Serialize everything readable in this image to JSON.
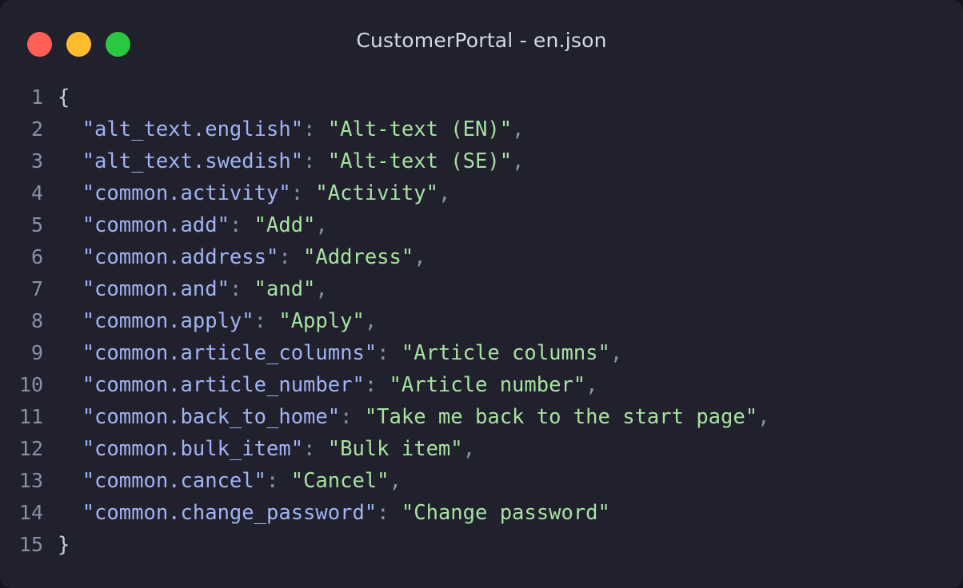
{
  "window": {
    "title": "CustomerPortal - en.json",
    "controls": [
      {
        "name": "close",
        "color": "#ff5f56"
      },
      {
        "name": "minimize",
        "color": "#ffbd2e"
      },
      {
        "name": "maximize",
        "color": "#28c840"
      }
    ]
  },
  "editor": {
    "language": "json",
    "colors": {
      "background": "#21212e",
      "line_number": "#8b90a8",
      "key": "#9fb4f2",
      "string": "#a7e2a0",
      "punctuation": "#c9ccda"
    },
    "lines": [
      {
        "number": "1",
        "indent": 0,
        "type": "brace",
        "text": "{"
      },
      {
        "number": "2",
        "indent": 1,
        "type": "pair",
        "key": "alt_text.english",
        "value": "Alt-text (EN)",
        "comma": ","
      },
      {
        "number": "3",
        "indent": 1,
        "type": "pair",
        "key": "alt_text.swedish",
        "value": "Alt-text (SE)",
        "comma": ","
      },
      {
        "number": "4",
        "indent": 1,
        "type": "pair",
        "key": "common.activity",
        "value": "Activity",
        "comma": ","
      },
      {
        "number": "5",
        "indent": 1,
        "type": "pair",
        "key": "common.add",
        "value": "Add",
        "comma": ","
      },
      {
        "number": "6",
        "indent": 1,
        "type": "pair",
        "key": "common.address",
        "value": "Address",
        "comma": ","
      },
      {
        "number": "7",
        "indent": 1,
        "type": "pair",
        "key": "common.and",
        "value": "and",
        "comma": ","
      },
      {
        "number": "8",
        "indent": 1,
        "type": "pair",
        "key": "common.apply",
        "value": "Apply",
        "comma": ","
      },
      {
        "number": "9",
        "indent": 1,
        "type": "pair",
        "key": "common.article_columns",
        "value": "Article columns",
        "comma": ","
      },
      {
        "number": "10",
        "indent": 1,
        "type": "pair",
        "key": "common.article_number",
        "value": "Article number",
        "comma": ","
      },
      {
        "number": "11",
        "indent": 1,
        "type": "pair",
        "key": "common.back_to_home",
        "value": "Take me back to the start page",
        "comma": ","
      },
      {
        "number": "12",
        "indent": 1,
        "type": "pair",
        "key": "common.bulk_item",
        "value": "Bulk item",
        "comma": ","
      },
      {
        "number": "13",
        "indent": 1,
        "type": "pair",
        "key": "common.cancel",
        "value": "Cancel",
        "comma": ","
      },
      {
        "number": "14",
        "indent": 1,
        "type": "pair",
        "key": "common.change_password",
        "value": "Change password",
        "comma": ""
      },
      {
        "number": "15",
        "indent": 0,
        "type": "brace",
        "text": "}"
      }
    ]
  }
}
